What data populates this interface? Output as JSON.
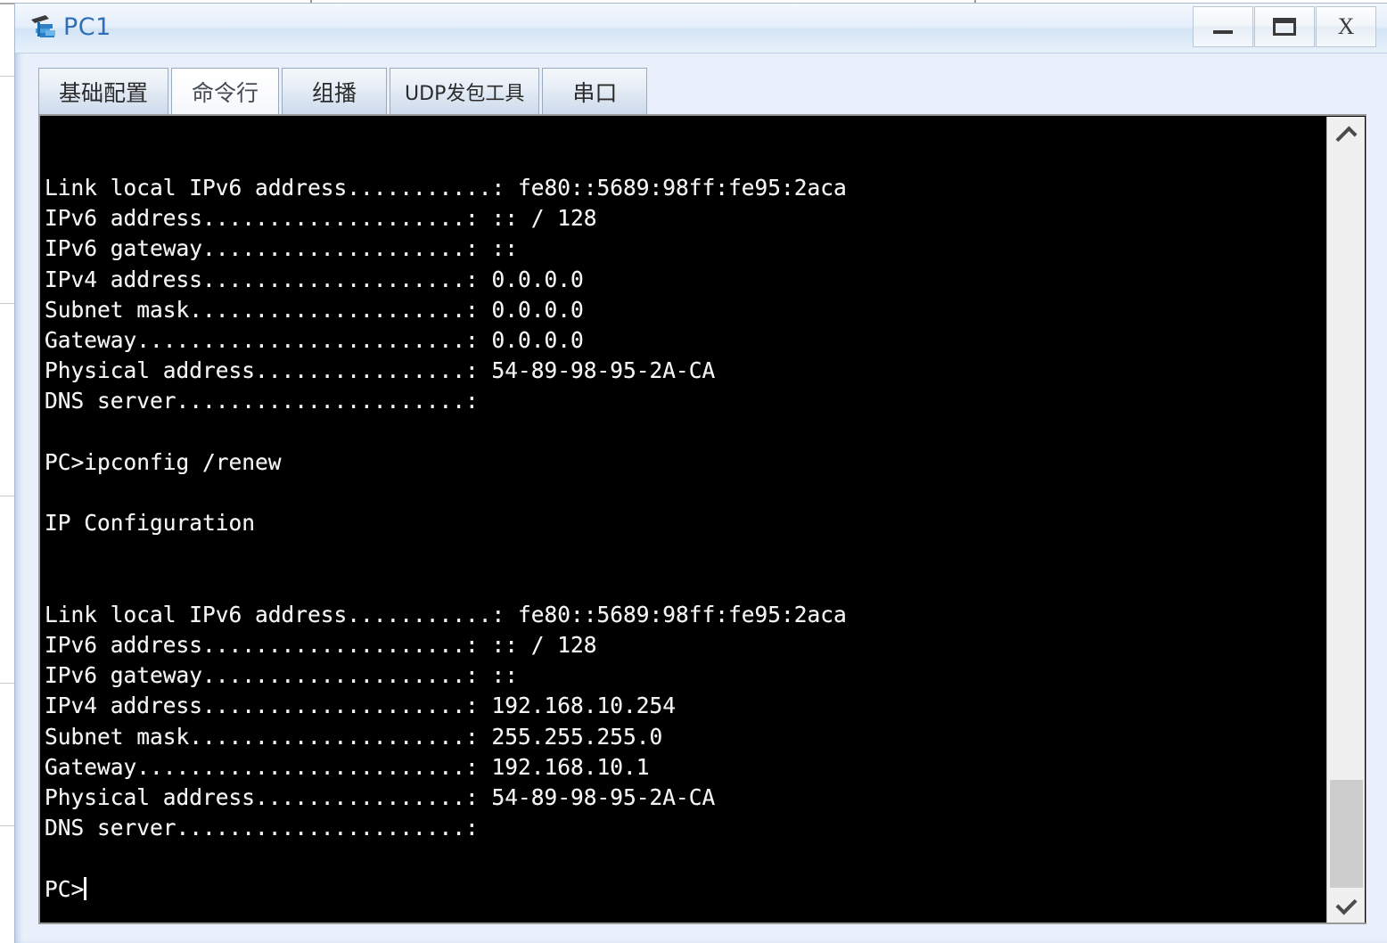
{
  "window": {
    "title": "PC1",
    "icon": "pc-terminal-icon",
    "controls": {
      "minimize_label": "—",
      "maximize_label": "❐",
      "close_label": "X"
    }
  },
  "tabs": [
    {
      "id": "basic-config",
      "label": "基础配置",
      "active": false
    },
    {
      "id": "command-line",
      "label": "命令行",
      "active": true
    },
    {
      "id": "multicast",
      "label": "组播",
      "active": false
    },
    {
      "id": "udp-tool",
      "label": "UDP发包工具",
      "active": false
    },
    {
      "id": "serial-port",
      "label": "串口",
      "active": false
    }
  ],
  "terminal": {
    "background_color": "#000000",
    "text_color": "#f2f2f2",
    "prompt": "PC>",
    "cursor_visible": true,
    "content": "Link local IPv6 address...........: fe80::5689:98ff:fe95:2aca\nIPv6 address....................: :: / 128\nIPv6 gateway....................: ::\nIPv4 address....................: 0.0.0.0\nSubnet mask.....................: 0.0.0.0\nGateway.........................: 0.0.0.0\nPhysical address................: 54-89-98-95-2A-CA\nDNS server......................: \n\nPC>ipconfig /renew\n\nIP Configuration\n\n\nLink local IPv6 address...........: fe80::5689:98ff:fe95:2aca\nIPv6 address....................: :: / 128\nIPv6 gateway....................: ::\nIPv4 address....................: 192.168.10.254\nSubnet mask.....................: 255.255.255.0\nGateway.........................: 192.168.10.1\nPhysical address................: 54-89-98-95-2A-CA\nDNS server......................: \n\nPC>",
    "blocks": [
      {
        "name": "ipconfig-output-before-renew",
        "rows": [
          {
            "label": "Link local IPv6 address...........",
            "value": "fe80::5689:98ff:fe95:2aca"
          },
          {
            "label": "IPv6 address....................",
            "value": ":: / 128"
          },
          {
            "label": "IPv6 gateway....................",
            "value": "::"
          },
          {
            "label": "IPv4 address....................",
            "value": "0.0.0.0"
          },
          {
            "label": "Subnet mask.....................",
            "value": "0.0.0.0"
          },
          {
            "label": "Gateway.........................",
            "value": "0.0.0.0"
          },
          {
            "label": "Physical address................",
            "value": "54-89-98-95-2A-CA"
          },
          {
            "label": "DNS server......................",
            "value": ""
          }
        ]
      },
      {
        "name": "command-line-entry",
        "command": "PC>ipconfig /renew",
        "heading": "IP Configuration"
      },
      {
        "name": "ipconfig-output-after-renew",
        "rows": [
          {
            "label": "Link local IPv6 address...........",
            "value": "fe80::5689:98ff:fe95:2aca"
          },
          {
            "label": "IPv6 address....................",
            "value": ":: / 128"
          },
          {
            "label": "IPv6 gateway....................",
            "value": "::"
          },
          {
            "label": "IPv4 address....................",
            "value": "192.168.10.254"
          },
          {
            "label": "Subnet mask.....................",
            "value": "255.255.255.0"
          },
          {
            "label": "Gateway.........................",
            "value": "192.168.10.1"
          },
          {
            "label": "Physical address................",
            "value": "54-89-98-95-2A-CA"
          },
          {
            "label": "DNS server......................",
            "value": ""
          }
        ]
      }
    ]
  },
  "scrollbar": {
    "orientation": "vertical",
    "up_arrow": "chevron-up-icon",
    "down_arrow": "chevron-down-icon",
    "thumb_position_percent": 86
  }
}
